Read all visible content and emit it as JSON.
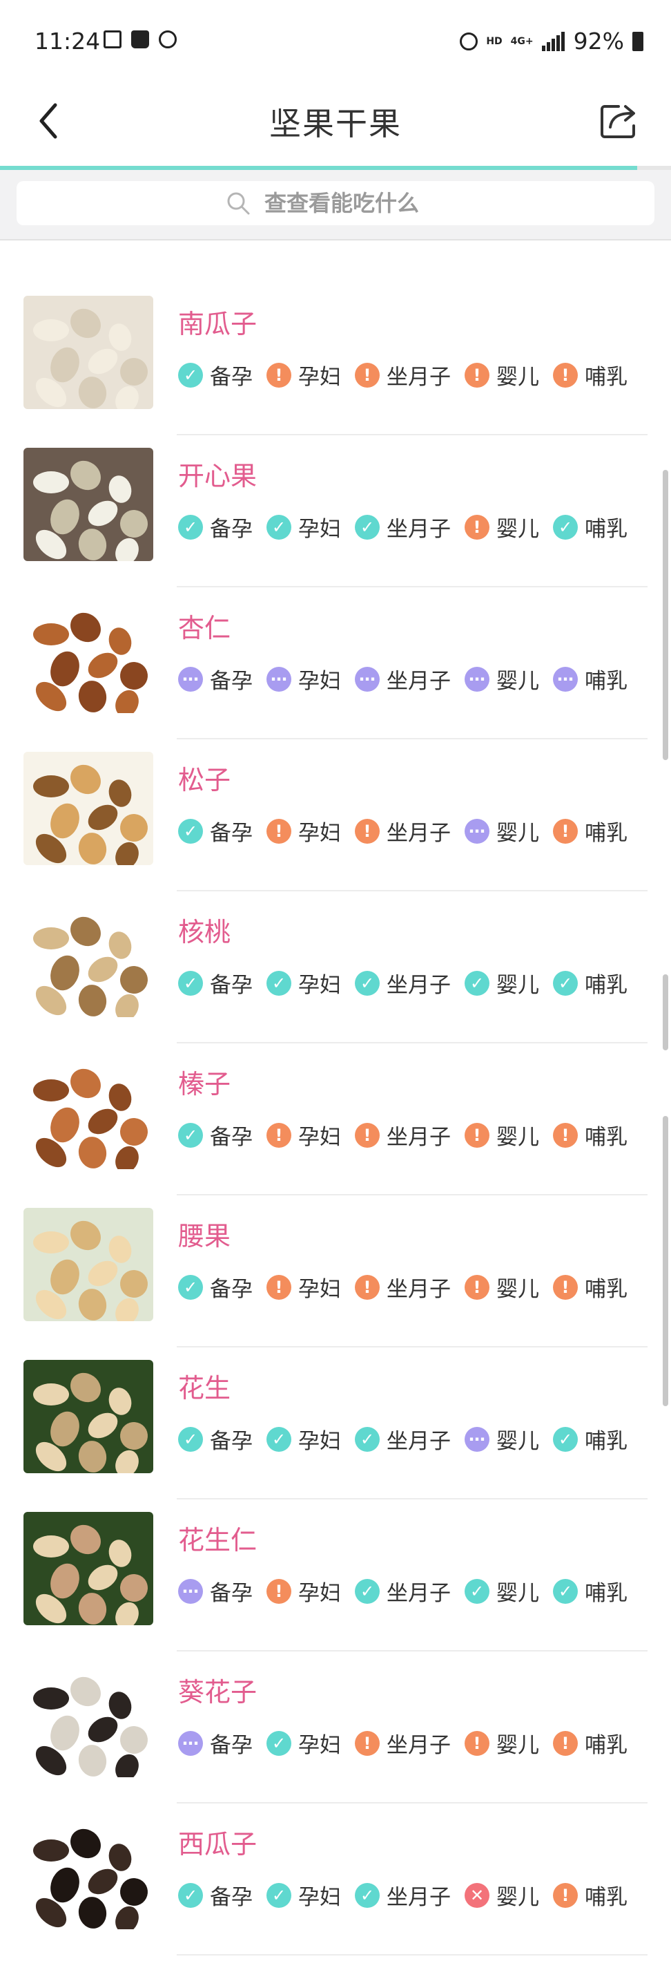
{
  "status_bar": {
    "time": "11:24",
    "hd": "HD",
    "network": "4G+",
    "battery": "92%"
  },
  "header": {
    "title": "坚果干果",
    "progress": 0.95
  },
  "search": {
    "placeholder": "查查看能吃什么"
  },
  "colors": {
    "accent": "#74dccf",
    "name": "#e25c8e",
    "ok": "#5fd8cf",
    "warn": "#f48d5c",
    "unknown": "#a89cf0",
    "no": "#f3727a"
  },
  "groups": [
    "备孕",
    "孕妇",
    "坐月子",
    "婴儿",
    "哺乳"
  ],
  "items": [
    {
      "name": "南瓜子",
      "image": "pumpkin-seeds",
      "status": [
        "ok",
        "warn",
        "warn",
        "warn",
        "warn"
      ]
    },
    {
      "name": "开心果",
      "image": "pistachios",
      "status": [
        "ok",
        "ok",
        "ok",
        "warn",
        "ok"
      ]
    },
    {
      "name": "杏仁",
      "image": "almonds",
      "status": [
        "unknown",
        "unknown",
        "unknown",
        "unknown",
        "unknown"
      ]
    },
    {
      "name": "松子",
      "image": "pine-nuts",
      "status": [
        "ok",
        "warn",
        "warn",
        "unknown",
        "warn"
      ]
    },
    {
      "name": "核桃",
      "image": "walnuts",
      "status": [
        "ok",
        "ok",
        "ok",
        "ok",
        "ok"
      ]
    },
    {
      "name": "榛子",
      "image": "hazelnuts",
      "status": [
        "ok",
        "warn",
        "warn",
        "warn",
        "warn"
      ]
    },
    {
      "name": "腰果",
      "image": "cashews",
      "status": [
        "ok",
        "warn",
        "warn",
        "warn",
        "warn"
      ]
    },
    {
      "name": "花生",
      "image": "peanuts",
      "status": [
        "ok",
        "ok",
        "ok",
        "unknown",
        "ok"
      ]
    },
    {
      "name": "花生仁",
      "image": "peanut-kernels",
      "status": [
        "unknown",
        "warn",
        "ok",
        "ok",
        "ok"
      ]
    },
    {
      "name": "葵花子",
      "image": "sunflower-seeds",
      "status": [
        "unknown",
        "ok",
        "warn",
        "warn",
        "warn"
      ]
    },
    {
      "name": "西瓜子",
      "image": "watermelon-seeds",
      "status": [
        "ok",
        "ok",
        "ok",
        "no",
        "warn"
      ]
    }
  ]
}
